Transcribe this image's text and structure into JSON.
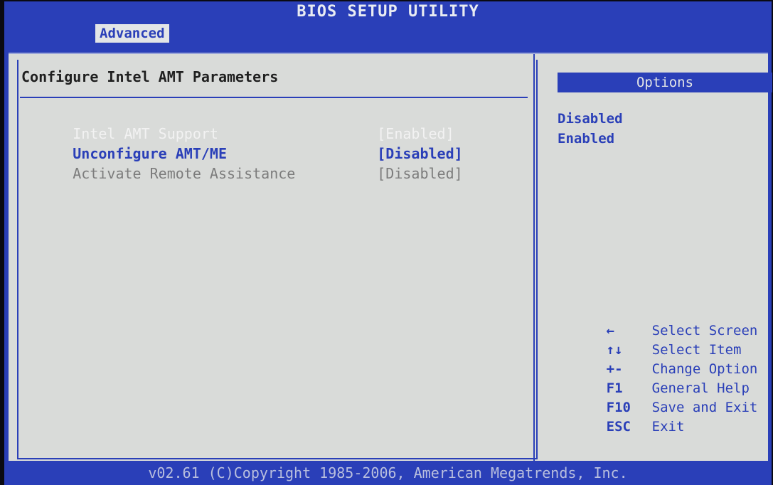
{
  "window": {
    "title": "BIOS SETUP UTILITY",
    "active_tab": "Advanced"
  },
  "main": {
    "title": "Configure Intel AMT Parameters",
    "items": [
      {
        "label": "Intel AMT Support",
        "value": "[Enabled]"
      },
      {
        "label": "Unconfigure AMT/ME",
        "value": "[Disabled]"
      },
      {
        "label": "Activate Remote Assistance",
        "value": "[Disabled]"
      }
    ]
  },
  "sidebar": {
    "header": "Options",
    "options": [
      "Disabled",
      "Enabled"
    ],
    "help": [
      {
        "key": "←",
        "text": "Select Screen"
      },
      {
        "key": "↑↓",
        "text": "Select Item"
      },
      {
        "key": "+-",
        "text": "Change Option"
      },
      {
        "key": "F1",
        "text": "General Help"
      },
      {
        "key": "F10",
        "text": "Save and Exit"
      },
      {
        "key": "ESC",
        "text": "Exit"
      }
    ]
  },
  "footer": {
    "text": "v02.61 (C)Copyright 1985-2006, American Megatrends, Inc."
  },
  "colors": {
    "bios_blue": "#2a3fb8",
    "panel_grey": "#d9dbd9",
    "highlight_white": "#f2f2f2",
    "disabled_grey": "#7c7c7c"
  }
}
